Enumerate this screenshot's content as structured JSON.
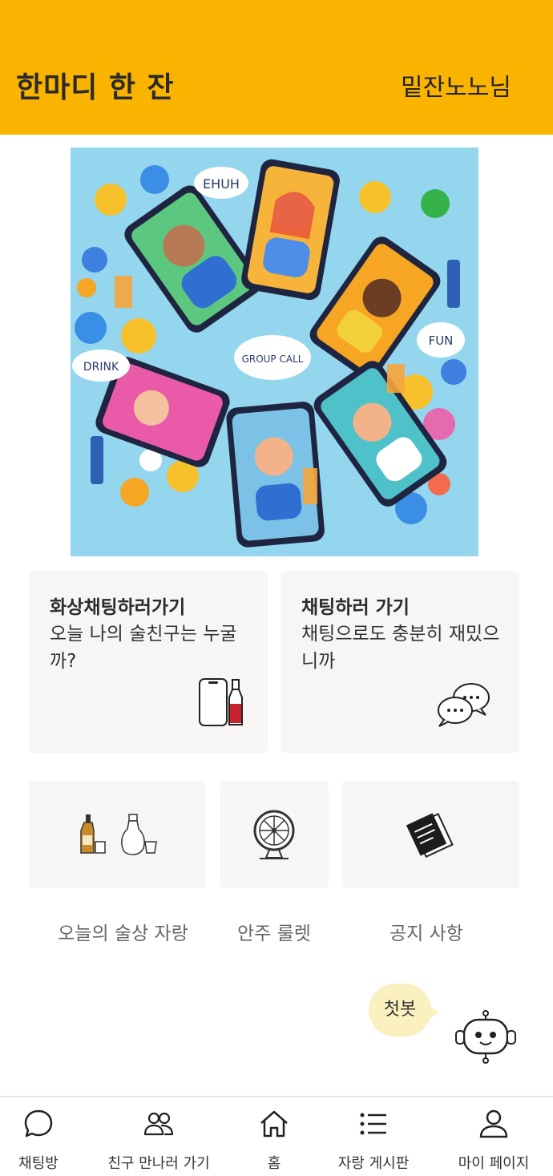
{
  "header": {
    "title": "한마디 한 잔",
    "user": "밑잔노노님"
  },
  "hero": {
    "speech_texts": [
      "EHUH",
      "DRINK",
      "GROUP CALL",
      "FUN"
    ]
  },
  "cards": [
    {
      "title": "화상채팅하러가기",
      "desc": "오늘 나의 술친구는 누굴까?"
    },
    {
      "title": "채팅하러 가기",
      "desc": "채팅으로도 충분히 재밌으니까"
    }
  ],
  "tiles": [
    {
      "label": "오늘의 술상 자랑",
      "icon": "liquor-bottles-icon"
    },
    {
      "label": "안주 룰렛",
      "icon": "roulette-wheel-icon"
    },
    {
      "label": "공지 사항",
      "icon": "notice-notes-icon"
    }
  ],
  "chatbot": {
    "label": "첫봇",
    "icon": "robot-icon"
  },
  "bottom_nav": [
    {
      "label": "채팅방",
      "icon": "chat-bubble-icon"
    },
    {
      "label": "친구 만나러 가기",
      "icon": "friends-icon"
    },
    {
      "label": "홈",
      "icon": "home-icon"
    },
    {
      "label": "자랑 게시판",
      "icon": "list-icon"
    },
    {
      "label": "마이 페이지",
      "icon": "person-icon"
    }
  ],
  "colors": {
    "accent": "#FAB400",
    "card_bg": "#F7F6F4",
    "bubble_bg": "#FBF0C0"
  }
}
